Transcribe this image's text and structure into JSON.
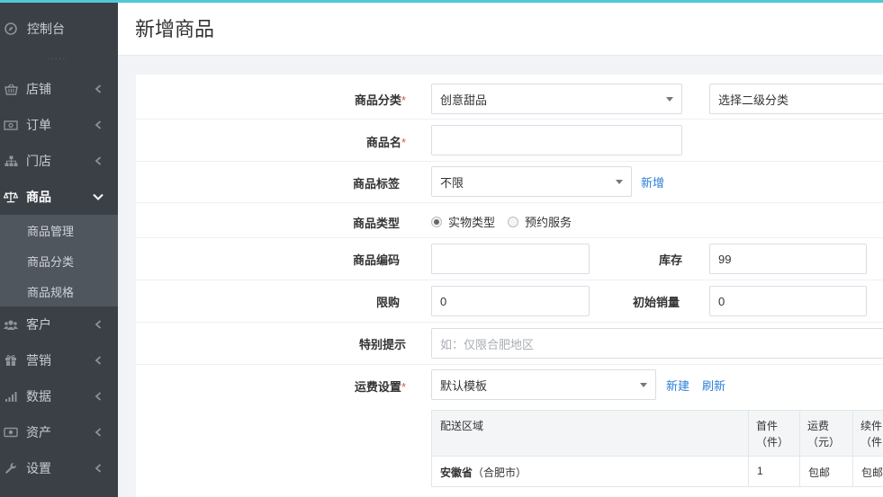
{
  "sidebar": {
    "top_item": "控制台",
    "items": [
      {
        "label": "店铺",
        "icon": "basket-icon"
      },
      {
        "label": "订单",
        "icon": "money-icon"
      },
      {
        "label": "门店",
        "icon": "sitemap-icon"
      },
      {
        "label": "商品",
        "icon": "balance-scale-icon",
        "active": true
      },
      {
        "label": "客户",
        "icon": "users-icon"
      },
      {
        "label": "营销",
        "icon": "gift-icon"
      },
      {
        "label": "数据",
        "icon": "bar-chart-icon"
      },
      {
        "label": "资产",
        "icon": "cash-icon"
      },
      {
        "label": "设置",
        "icon": "wrench-icon"
      }
    ],
    "sub_items": [
      "商品管理",
      "商品分类",
      "商品规格"
    ]
  },
  "header": {
    "title": "新增商品"
  },
  "form": {
    "category": {
      "label": "商品分类",
      "value": "创意甜品",
      "sub_value": "选择二级分类"
    },
    "name": {
      "label": "商品名",
      "value": ""
    },
    "tag": {
      "label": "商品标签",
      "value": "不限",
      "add_link": "新增"
    },
    "type": {
      "label": "商品类型",
      "options": [
        "实物类型",
        "预约服务"
      ],
      "selected": "实物类型"
    },
    "code": {
      "label": "商品编码",
      "value": ""
    },
    "stock": {
      "label": "库存",
      "value": "99"
    },
    "limit": {
      "label": "限购",
      "value": "0"
    },
    "initial_sales": {
      "label": "初始销量",
      "value": "0"
    },
    "tip": {
      "label": "特别提示",
      "placeholder": "如：仅限合肥地区"
    },
    "shipping": {
      "label": "运费设置",
      "value": "默认模板",
      "new_link": "新建",
      "refresh_link": "刷新"
    }
  },
  "freight_table": {
    "headers": [
      "配送区域",
      "首件\n（件）",
      "运费\n（元）",
      "续件\n（件"
    ],
    "rows": [
      {
        "region_bold": "安徽省",
        "region_rest": "（合肥市）",
        "first": "1",
        "fee": "包邮",
        "extra": "包邮"
      }
    ]
  }
}
